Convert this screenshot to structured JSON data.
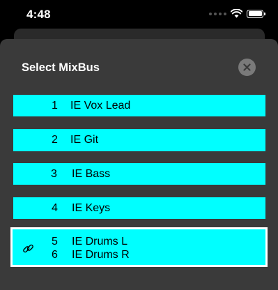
{
  "status_bar": {
    "time": "4:48"
  },
  "sheet": {
    "title": "Select MixBus",
    "close_icon": "close-icon"
  },
  "mixbuses": [
    {
      "num": "1",
      "label": "IE Vox Lead"
    },
    {
      "num": "2",
      "label": "IE Git"
    },
    {
      "num": "3",
      "label": "IE Bass"
    },
    {
      "num": "4",
      "label": "IE Keys"
    }
  ],
  "linked_mixbus": {
    "icon": "link-icon",
    "selected": true,
    "entries": [
      {
        "num": "5",
        "label": "IE Drums L"
      },
      {
        "num": "6",
        "label": "IE Drums R"
      }
    ]
  },
  "colors": {
    "row_background": "#00ffff",
    "sheet_background": "#3a3a3a",
    "selected_border": "#ffffff"
  }
}
